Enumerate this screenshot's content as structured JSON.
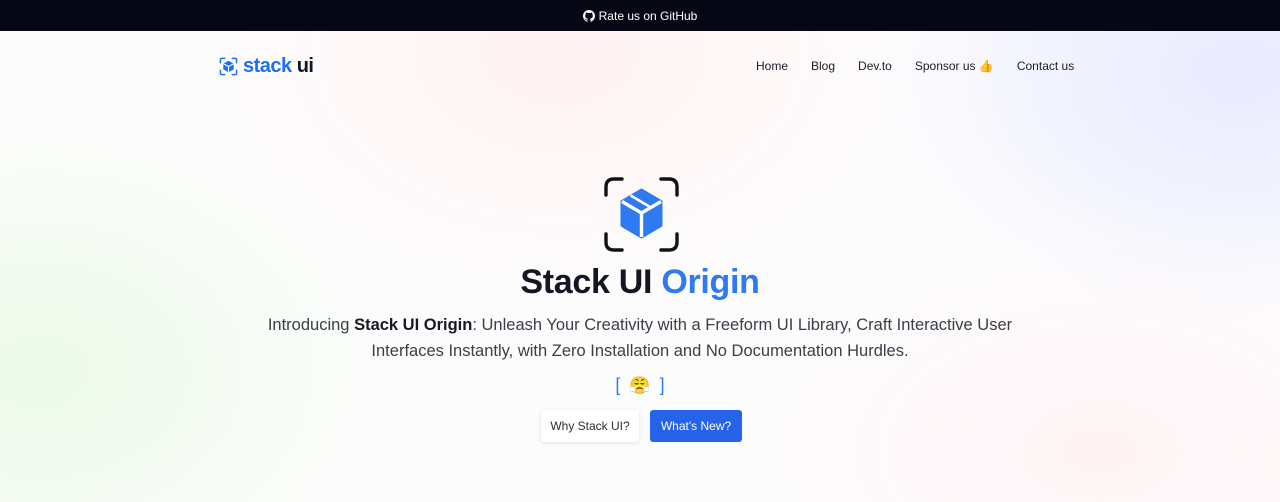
{
  "topbar": {
    "label": "Rate us on GitHub",
    "icon": "github-icon"
  },
  "brand": {
    "logo_part1": "stack",
    "logo_part2": "ui",
    "accent_color": "#1e6ff2",
    "dark_color": "#111625"
  },
  "nav": {
    "items": [
      "Home",
      "Blog",
      "Dev.to",
      "Sponsor us",
      "Contact us"
    ],
    "sponsor_emoji": "👍"
  },
  "hero": {
    "title_main": "Stack UI",
    "title_accent": "Origin",
    "intro_prefix": "Introducing ",
    "intro_bold": "Stack UI Origin",
    "intro_rest": ": Unleash Your Creativity with a Freeform UI Library, Craft Interactive User Interfaces Instantly, with Zero Installation and No Documentation Hurdles.",
    "bracket_open": "[",
    "bracket_emoji": "😤",
    "bracket_close": "]",
    "icon": "cube-icon"
  },
  "buttons": {
    "secondary": "Why Stack UI?",
    "primary": "What's New?"
  },
  "colors": {
    "primary_button": "#2563eb",
    "title_accent": "#2f7af0",
    "topbar_bg": "#050814"
  }
}
